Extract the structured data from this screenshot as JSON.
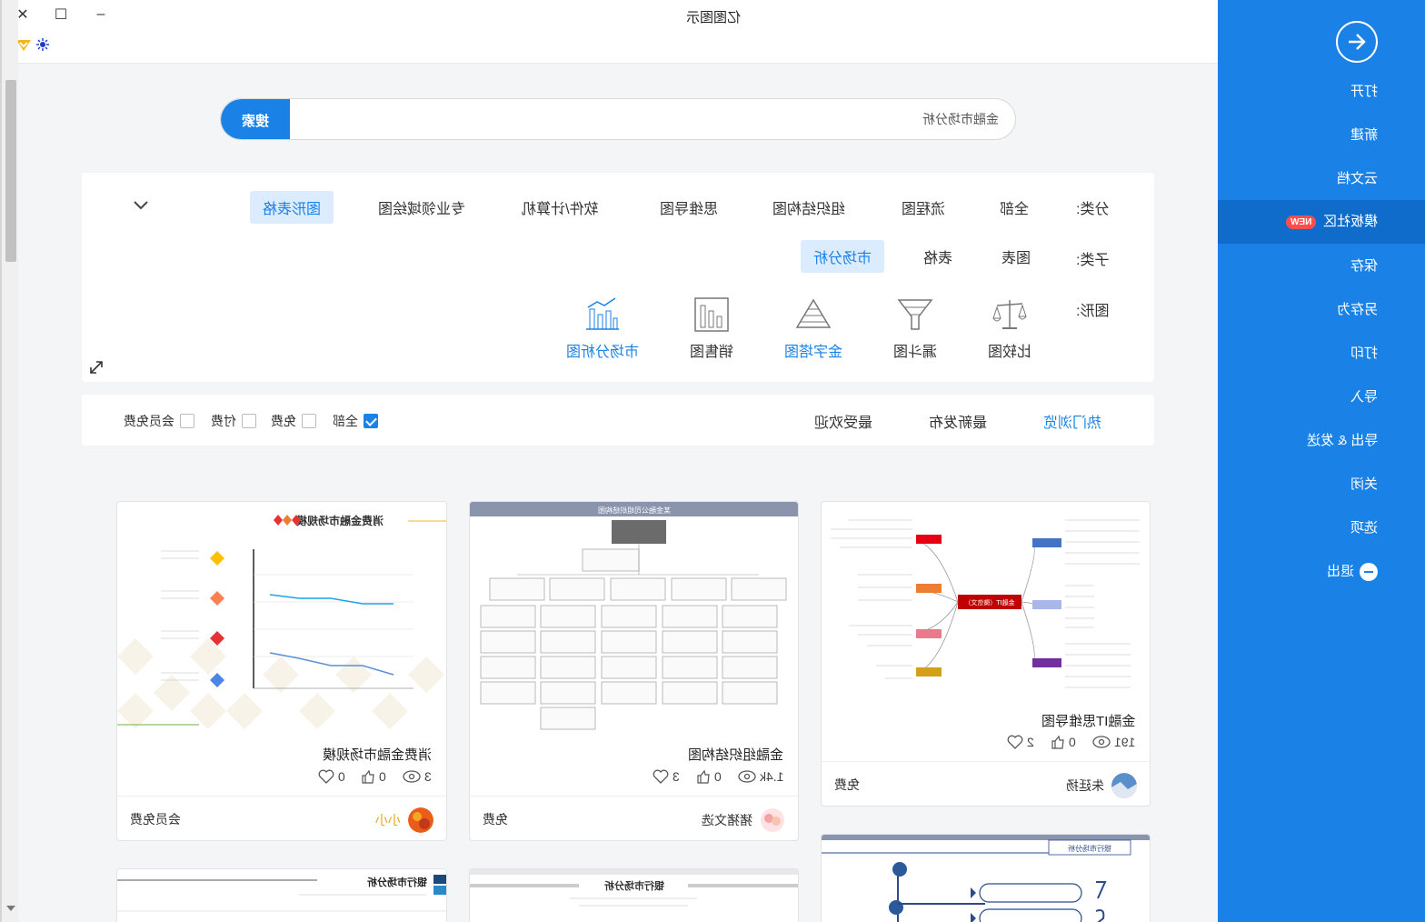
{
  "window": {
    "title": "亿图图示",
    "close_glyph": "✕",
    "maximize_glyph": "☐",
    "minimize_glyph": "–"
  },
  "sidebar": {
    "items": [
      {
        "label": "打开"
      },
      {
        "label": "新建"
      },
      {
        "label": "云文档"
      },
      {
        "label": "模板社区",
        "badge": "NEW"
      },
      {
        "label": "保存"
      },
      {
        "label": "另存为"
      },
      {
        "label": "打印"
      },
      {
        "label": "导入"
      },
      {
        "label": "导出 & 发送"
      },
      {
        "label": "关闭"
      },
      {
        "label": "选项"
      },
      {
        "label": "退出"
      }
    ]
  },
  "search": {
    "button_label": "搜索",
    "value": "金融市场分析"
  },
  "filters": {
    "category_label": "分类:",
    "categories": [
      "全部",
      "流程图",
      "组织结构图",
      "思维导图",
      "软件/计算机",
      "专业领域绘图",
      "图形表格"
    ],
    "subcategory_label": "子类:",
    "subcategories": [
      "图表",
      "表格",
      "市场分析"
    ],
    "shape_label": "图形:",
    "shapes": [
      "比较图",
      "漏斗图",
      "金字塔图",
      "销售图",
      "市场分析图"
    ]
  },
  "sort": {
    "options": [
      "热门浏览",
      "最新发布",
      "最受欢迎"
    ],
    "filters": [
      "全部",
      "免费",
      "付费",
      "会员免费"
    ]
  },
  "cards": [
    {
      "title": "金融IT思维导图",
      "views": "191",
      "likes": "0",
      "favorites": "2",
      "author": "朱廷扬",
      "price": "免费"
    },
    {
      "title": "金融组织结构图",
      "views": "1.4k",
      "likes": "0",
      "favorites": "3",
      "author": "猪猪文选",
      "price": "免费"
    },
    {
      "title": "消费金融市场规模",
      "views": "3",
      "likes": "0",
      "favorites": "0",
      "author": "小小",
      "price": "会员免费"
    }
  ],
  "thumb_text": {
    "mindmap_center": "金融IT（微信文）",
    "orgchart_header": "某金融公司组织结构图",
    "linechart_title": "消费金融市场规模",
    "bottom_left_title": "银行市场分析",
    "bottom_mid_title": "银行市场分析",
    "bottom_right_title": "银行市场分析"
  },
  "colors": {
    "accent": "#1a82e6",
    "sidebar": "#1a82e6",
    "sidebar_active": "#0f6ccb",
    "badge": "#ff4d4f"
  }
}
